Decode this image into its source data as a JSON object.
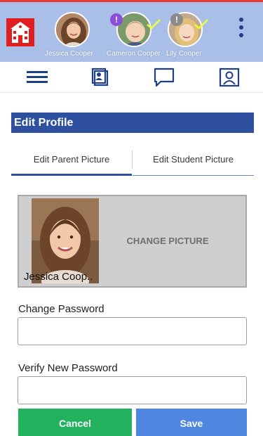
{
  "header": {
    "background_color": "#a9bfe8",
    "accent_color": "#e02020",
    "school_icon": "school-building-icon",
    "profiles": [
      {
        "name": "Jessica Cooper",
        "alert": null,
        "checked": false
      },
      {
        "name": "Cameron Cooper",
        "alert": "!",
        "alert_color": "#8a4fd8",
        "checked": true
      },
      {
        "name": "Lily Cooper",
        "alert": "!",
        "alert_color": "#8a8a8a",
        "checked": true
      }
    ],
    "menu_icon": "kebab-menu-icon"
  },
  "nav": {
    "items": [
      {
        "icon": "hamburger-menu-icon"
      },
      {
        "icon": "student-cards-icon"
      },
      {
        "icon": "chat-bubble-icon"
      },
      {
        "icon": "profile-icon"
      }
    ],
    "icon_color": "#1e3f8a"
  },
  "page": {
    "title": "Edit Profile",
    "title_color": "#2f509e",
    "tabs": [
      {
        "label": "Edit Parent Picture",
        "active": true
      },
      {
        "label": "Edit Student Picture",
        "active": false
      }
    ],
    "picture": {
      "name": "Jessica Coop..",
      "change_label": "CHANGE PICTURE"
    },
    "fields": [
      {
        "label": "Change Password",
        "value": "",
        "placeholder": ""
      },
      {
        "label": "Verify New Password",
        "value": "",
        "placeholder": ""
      }
    ],
    "buttons": {
      "cancel_label": "Cancel",
      "save_label": "Save",
      "cancel_color": "#22b15d",
      "save_color": "#4f86e0"
    }
  }
}
